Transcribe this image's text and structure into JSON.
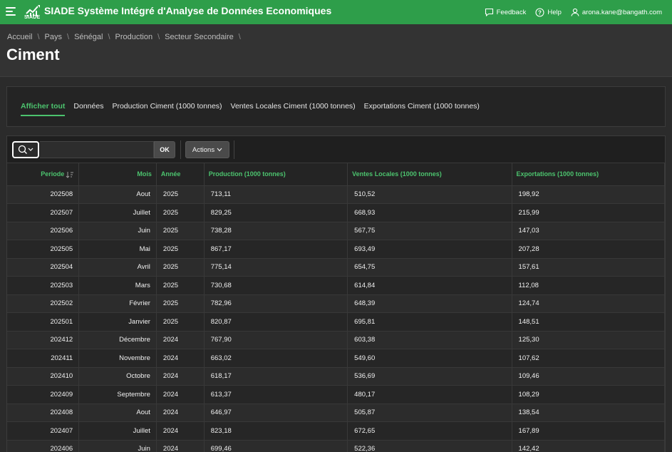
{
  "app": {
    "logo_text": "SIADE",
    "title": "SIADE Système Intégré d'Analyse de Données Economiques",
    "feedback_label": "Feedback",
    "help_label": "Help",
    "user_label": "arona.kane@bangath.com"
  },
  "breadcrumb": [
    "Accueil",
    "Pays",
    "Sénégal",
    "Production",
    "Secteur Secondaire"
  ],
  "page_title": "Ciment",
  "tabs": [
    {
      "label": "Afficher tout",
      "active": true
    },
    {
      "label": "Données"
    },
    {
      "label": "Production Ciment (1000 tonnes)"
    },
    {
      "label": "Ventes Locales Ciment (1000 tonnes)"
    },
    {
      "label": "Exportations Ciment (1000 tonnes)"
    }
  ],
  "toolbar": {
    "search_value": "",
    "ok_label": "OK",
    "actions_label": "Actions"
  },
  "table": {
    "columns": [
      "Periode",
      "Mois",
      "Année",
      "Production (1000 tonnes)",
      "Ventes Locales (1000 tonnes)",
      "Exportations (1000 tonnes)"
    ],
    "rows": [
      [
        "202508",
        "Aout",
        "2025",
        "713,11",
        "510,52",
        "198,92"
      ],
      [
        "202507",
        "Juillet",
        "2025",
        "829,25",
        "668,93",
        "215,99"
      ],
      [
        "202506",
        "Juin",
        "2025",
        "738,28",
        "567,75",
        "147,03"
      ],
      [
        "202505",
        "Mai",
        "2025",
        "867,17",
        "693,49",
        "207,28"
      ],
      [
        "202504",
        "Avril",
        "2025",
        "775,14",
        "654,75",
        "157,61"
      ],
      [
        "202503",
        "Mars",
        "2025",
        "730,68",
        "614,84",
        "112,08"
      ],
      [
        "202502",
        "Février",
        "2025",
        "782,96",
        "648,39",
        "124,74"
      ],
      [
        "202501",
        "Janvier",
        "2025",
        "820,87",
        "695,81",
        "148,51"
      ],
      [
        "202412",
        "Décembre",
        "2024",
        "767,90",
        "603,38",
        "125,30"
      ],
      [
        "202411",
        "Novembre",
        "2024",
        "663,02",
        "549,60",
        "107,62"
      ],
      [
        "202410",
        "Octobre",
        "2024",
        "618,17",
        "536,69",
        "109,46"
      ],
      [
        "202409",
        "Septembre",
        "2024",
        "613,37",
        "480,17",
        "108,29"
      ],
      [
        "202408",
        "Aout",
        "2024",
        "646,97",
        "505,87",
        "138,54"
      ],
      [
        "202407",
        "Juillet",
        "2024",
        "823,18",
        "672,65",
        "167,89"
      ],
      [
        "202406",
        "Juin",
        "2024",
        "699,46",
        "522,36",
        "142,42"
      ]
    ]
  }
}
